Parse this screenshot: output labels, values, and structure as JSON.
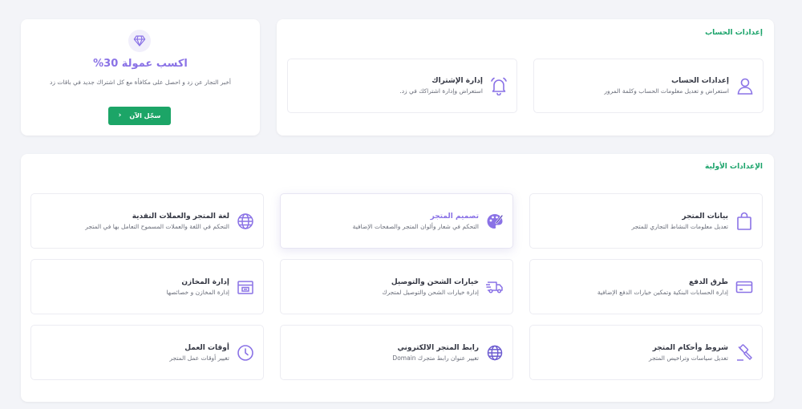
{
  "account_settings": {
    "title": "إعدادات الحساب",
    "tiles": [
      {
        "icon": "user-icon",
        "title": "إعدادات الحساب",
        "desc": "استعراض و تعديل معلومات الحساب وكلمة المرور"
      },
      {
        "icon": "bell-icon",
        "title": "إدارة الإشتراك",
        "desc": "استعراض وإدارة اشتراكك في زد."
      }
    ]
  },
  "promo": {
    "icon": "diamond-icon",
    "title": "اكسب عمولة 30%",
    "desc": "أخبر التجار عن زد و احصل على مكافأة مع كل اشتراك جديد في باقات زد",
    "button_label": "سجّل الآن",
    "button_icon": "chevron-left-icon"
  },
  "initial_settings": {
    "title": "الإعدادات الأولية",
    "tiles": [
      {
        "icon": "shopping-bag-icon",
        "title": "بيانات المتجر",
        "desc": "تعديل معلومات النشاط التجاري للمتجر"
      },
      {
        "icon": "palette-icon",
        "title": "تصميم المتجر",
        "desc": "التحكم في شعار وألوان المتجر والصفحات الإضافية"
      },
      {
        "icon": "globe-icon",
        "title": "لغة المتجر والعملات النقدية",
        "desc": "التحكم في اللغة والعملات المسموح التعامل بها في المتجر"
      },
      {
        "icon": "credit-card-icon",
        "title": "طرق الدفع",
        "desc": "إدارة الحسابات البنكية وتمكين خيارات الدفع الإضافية"
      },
      {
        "icon": "delivery-truck-icon",
        "title": "خيارات الشحن والتوصيل",
        "desc": "إدارة خيارات الشحن والتوصيل لمتجرك"
      },
      {
        "icon": "warehouse-box-icon",
        "title": "إدارة المخازن",
        "desc": "إدارة المخازن و خصائصها"
      },
      {
        "icon": "gavel-icon",
        "title": "شروط وأحكام المتجر",
        "desc": "تعديل سياسات وتراخيص المتجر"
      },
      {
        "icon": "world-link-icon",
        "title": "رابط المتجر الالكتروني",
        "desc": "تغيير عنوان رابط متجرك Domain"
      },
      {
        "icon": "clock-icon",
        "title": "أوقات العمل",
        "desc": "تغيير أوقات عمل المتجر"
      }
    ]
  },
  "colors": {
    "accent_purple": "#8a72e6",
    "accent_green": "#1ca567",
    "background": "#f3f4f8"
  }
}
